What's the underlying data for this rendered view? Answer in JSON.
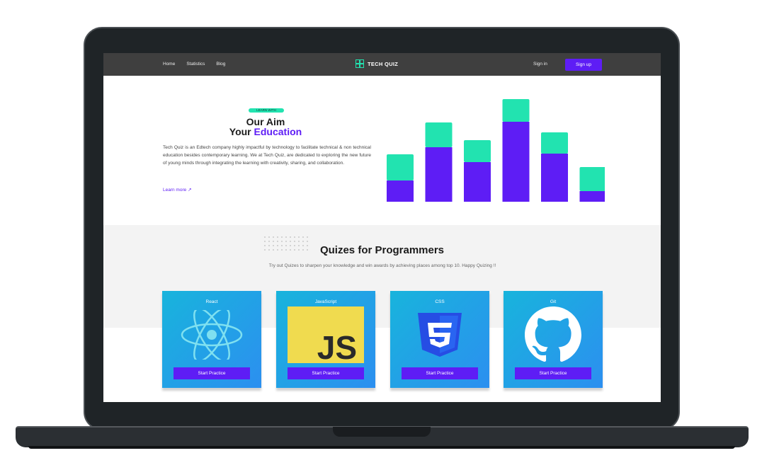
{
  "nav": {
    "links": [
      "Home",
      "Statistics",
      "Blog"
    ],
    "brand": "TECH QUIZ",
    "signin": "Sign in",
    "signup": "Sign up"
  },
  "hero": {
    "badge": "LEARN WITH",
    "title_line1": "Our Aim",
    "title_line2_pre": "Your ",
    "title_line2_accent": "Education",
    "description": "Tech Quiz is an Edtech company highly impactful by technology to facilitate technical & non technical education besides contemporary learning. We at Tech Quiz, are dedicated to exploring the new future of young minds through integrating the learning with creativity, sharing, and collaboration.",
    "learn_more": "Learn more"
  },
  "chart_data": {
    "type": "bar",
    "series": [
      {
        "values": [
          30,
          77,
          56,
          113,
          68,
          15
        ]
      },
      {
        "values": [
          37,
          35,
          31,
          32,
          30,
          34
        ]
      }
    ],
    "colors": [
      "#5e1df5",
      "#22e3b0"
    ]
  },
  "quizzes": {
    "title": "Quizes for Programmers",
    "subtitle": "Try out Quizes to sharpen your knowledge and win awards by achieving places among top 10. Happy Quizing !!",
    "cards": [
      {
        "name": "React",
        "button": "Start Practice",
        "icon": "react-icon"
      },
      {
        "name": "JavaScript",
        "button": "Start Practice",
        "icon": "javascript-icon"
      },
      {
        "name": "CSS",
        "button": "Start Practice",
        "icon": "css3-icon"
      },
      {
        "name": "Git",
        "button": "Start Practice",
        "icon": "github-icon"
      }
    ]
  },
  "colors": {
    "accent": "#5e1df5",
    "teal": "#22e3b0",
    "nav_bg": "#3f3f3f"
  }
}
